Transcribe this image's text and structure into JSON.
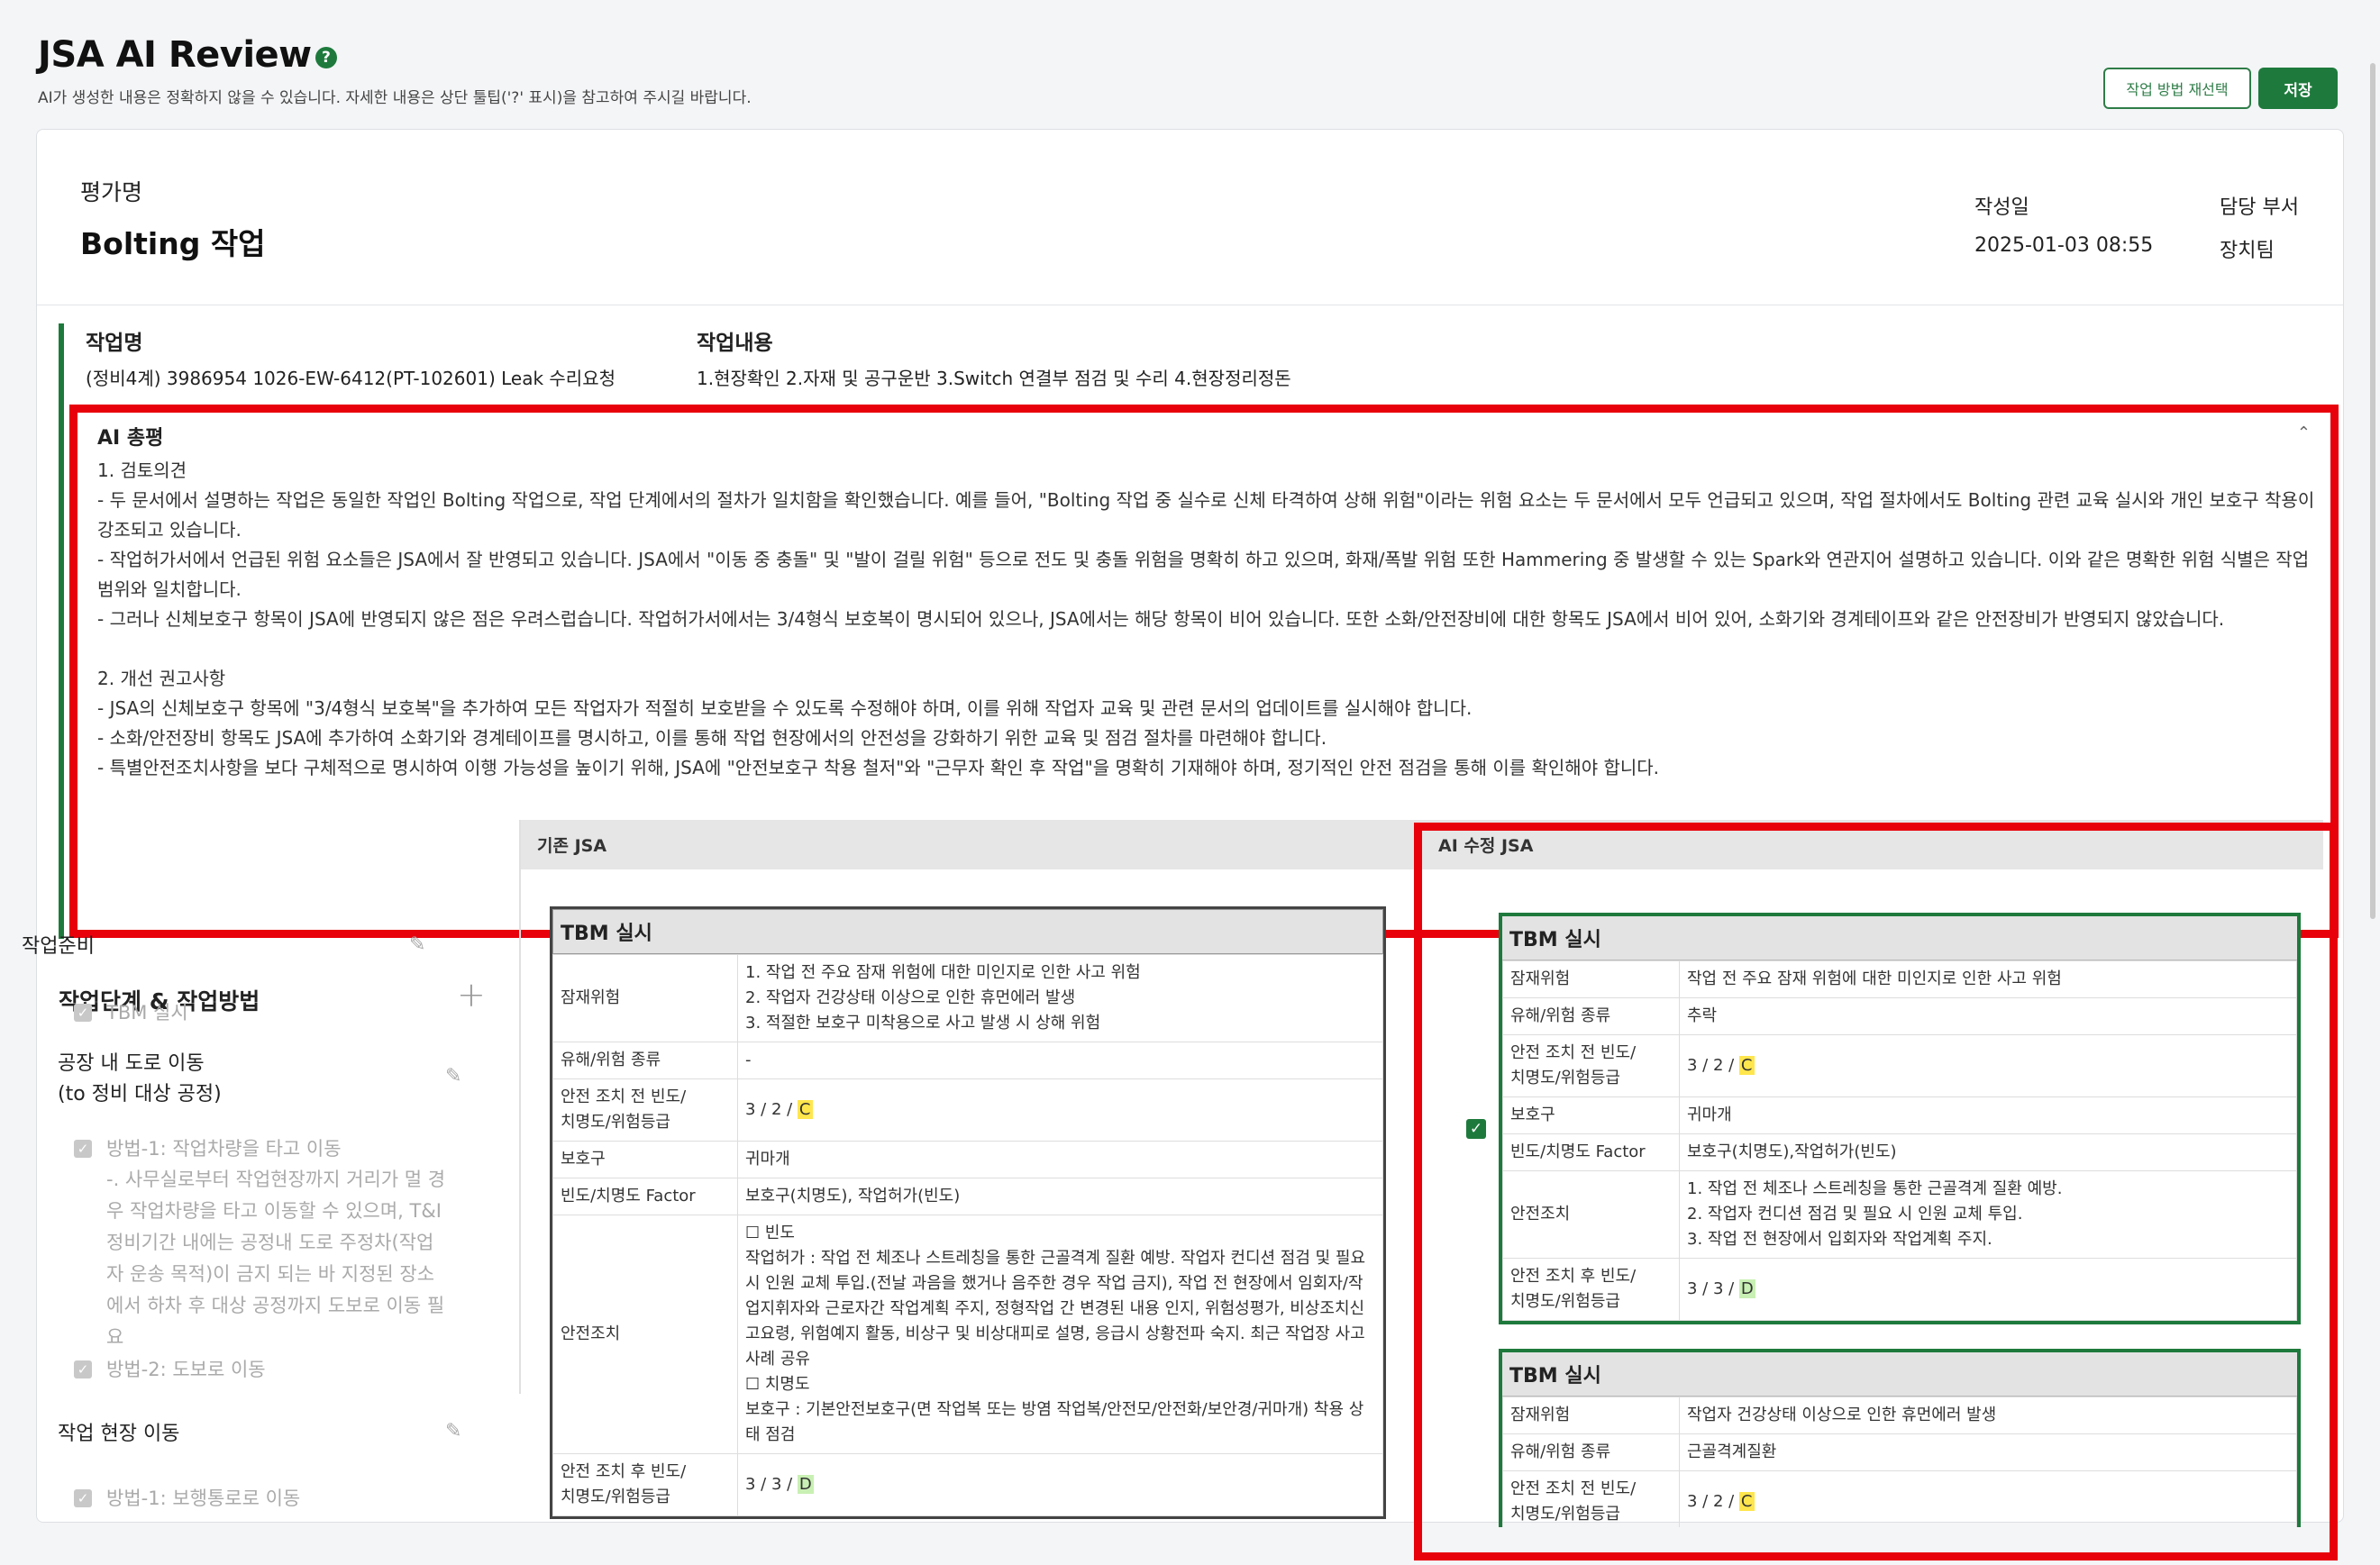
{
  "header": {
    "title": "JSA AI Review",
    "help_icon": "help-icon",
    "subtitle": "AI가 생성한 내용은 정확하지 않을 수 있습니다. 자세한 내용은 상단 툴팁('?' 표시)을 참고하여 주시길 바랍니다.",
    "reselect_button": "작업 방법 재선택",
    "save_button": "저장"
  },
  "evaluation": {
    "name_label": "평가명",
    "name": "Bolting 작업",
    "date_label": "작성일",
    "date": "2025-01-03 08:55",
    "dept_label": "담당 부서",
    "dept": "장치팀"
  },
  "job": {
    "name_label": "작업명",
    "name": "(정비4계) 3986954 1026-EW-6412(PT-102601) Leak 수리요청",
    "content_label": "작업내용",
    "content": "1.현장확인 2.자재 및 공구운반 3.Switch 연결부 점검 및 수리 4.현장정리정돈"
  },
  "ai_summary": {
    "title": "AI 총평",
    "lines": [
      "1. 검토의견",
      "  - 두 문서에서 설명하는 작업은 동일한 작업인 Bolting 작업으로, 작업 단계에서의 절차가 일치함을 확인했습니다. 예를 들어, \"Bolting 작업 중 실수로 신체 타격하여 상해 위험\"이라는 위험 요소는 두 문서에서 모두 언급되고 있으며, 작업 절차에서도 Bolting 관련 교육 실시와 개인 보호구 착용이 강조되고 있습니다.",
      "  - 작업허가서에서 언급된 위험 요소들은 JSA에서 잘 반영되고 있습니다. JSA에서 \"이동 중 충돌\" 및 \"발이 걸릴 위험\" 등으로 전도 및 충돌 위험을 명확히 하고 있으며, 화재/폭발 위험 또한 Hammering 중 발생할 수 있는 Spark와 연관지어 설명하고 있습니다. 이와 같은 명확한 위험 식별은 작업 범위와 일치합니다.",
      "  - 그러나 신체보호구 항목이 JSA에 반영되지 않은 점은 우려스럽습니다. 작업허가서에서는 3/4형식 보호복이 명시되어 있으나, JSA에서는 해당 항목이 비어 있습니다. 또한 소화/안전장비에 대한 항목도 JSA에서 비어 있어, 소화기와 경계테이프와 같은 안전장비가 반영되지 않았습니다.",
      "",
      "2. 개선 권고사항",
      "  - JSA의 신체보호구 항목에 \"3/4형식 보호복\"을 추가하여 모든 작업자가 적절히 보호받을 수 있도록 수정해야 하며, 이를 위해 작업자 교육 및 관련 문서의 업데이트를 실시해야 합니다.",
      "  - 소화/안전장비 항목도 JSA에 추가하여 소화기와 경계테이프를 명시하고, 이를 통해 작업 현장에서의 안전성을 강화하기 위한 교육 및 점검 절차를 마련해야 합니다.",
      "  - 특별안전조치사항을 보다 구체적으로 명시하여 이행 가능성을 높이기 위해, JSA에 \"안전보호구 착용 철저\"와 \"근무자 확인 후 작업\"을 명확히 기재해야 하며, 정기적인 안전 점검을 통해 이를 확인해야 합니다."
    ]
  },
  "steps_panel": {
    "title": "작업단계 & 작업방법",
    "stages": [
      {
        "label": "작업준비",
        "methods": [
          "TBM 실시"
        ]
      },
      {
        "label": "공장 내 도로 이동\n(to 정비 대상 공정)",
        "methods": [
          "방법-1: 작업차량을 타고 이동",
          "방법-2: 도보로 이동"
        ],
        "desc": "-. 사무실로부터 작업현장까지 거리가 멀 경우 작업차량을 타고 이동할 수 있으며, T&I 정비기간 내에는 공정내 도로 주정차(작업자 운송 목적)이 금지 되는 바 지정된 장소에서 하차 후 대상 공정까지 도보로 이동 필요"
      },
      {
        "label": "작업 현장 이동",
        "methods": [
          "방법-1: 보행통로로 이동"
        ]
      }
    ]
  },
  "existing_jsa": {
    "column_title": "기존 JSA",
    "table_title": "TBM 실시",
    "rows": {
      "hazard_k": "잠재위험",
      "hazard_v": "1. 작업 전 주요 잠재 위험에 대한 미인지로 인한 사고 위험\n2. 작업자 건강상태 이상으로 인한 휴먼에러 발생\n3. 적절한 보호구 미착용으로 사고 발생 시 상해 위험",
      "type_k": "유해/위험 종류",
      "type_v": "-",
      "pre_k": "안전 조치 전 빈도/\n치명도/위험등급",
      "pre_v": "3 / 2 / ",
      "pre_grade": "C",
      "ppe_k": "보호구",
      "ppe_v": "귀마개",
      "factor_k": "빈도/치명도 Factor",
      "factor_v": "보호구(치명도), 작업허가(빈도)",
      "measure_k": "안전조치",
      "measure_v": "☐ 빈도\n작업허가 : 작업 전 체조나 스트레칭을 통한 근골격계 질환 예방. 작업자 컨디션 점검 및 필요 시 인원 교체 투입.(전날 과음을 했거나 음주한 경우 작업 금지), 작업 전 현장에서 임회자/작업지휘자와 근로자간 작업계획 주지, 정형작업 간 변경된 내용 인지, 위험성평가, 비상조치신고요령, 위험예지 활동, 비상구 및 비상대피로 설명, 응급시 상황전파 숙지. 최근 작업장 사고사례 공유\n☐ 치명도\n보호구 : 기본안전보호구(면 작업복 또는 방염 작업복/안전모/안전화/보안경/귀마개) 착용 상태 점검",
      "post_k": "안전 조치 후 빈도/\n치명도/위험등급",
      "post_v": "3 / 3 / ",
      "post_grade": "D"
    }
  },
  "ai_jsa": {
    "column_title": "AI 수정 JSA",
    "tables": [
      {
        "title": "TBM 실시",
        "hazard_k": "잠재위험",
        "hazard_v": "작업 전 주요 잠재 위험에 대한 미인지로 인한 사고 위험",
        "type_k": "유해/위험 종류",
        "type_v": "추락",
        "pre_k": "안전 조치 전 빈도/\n치명도/위험등급",
        "pre_v": "3 / 2 / ",
        "pre_grade": "C",
        "ppe_k": "보호구",
        "ppe_v": "귀마개",
        "factor_k": "빈도/치명도 Factor",
        "factor_v": "보호구(치명도),작업허가(빈도)",
        "measure_k": "안전조치",
        "measure_v": "1. 작업 전 체조나 스트레칭을 통한 근골격계 질환 예방.\n2. 작업자 컨디션 점검 및 필요 시 인원 교체 투입.\n3. 작업 전 현장에서 입회자와 작업계획 주지.",
        "post_k": "안전 조치 후 빈도/\n치명도/위험등급",
        "post_v": "3 / 3 / ",
        "post_grade": "D"
      },
      {
        "title": "TBM 실시",
        "hazard_k": "잠재위험",
        "hazard_v": "작업자 건강상태 이상으로 인한 휴먼에러 발생",
        "type_k": "유해/위험 종류",
        "type_v": "근골격계질환",
        "pre_k": "안전 조치 전 빈도/\n치명도/위험등급",
        "pre_v": "3 / 2 / ",
        "pre_grade": "C"
      }
    ]
  },
  "colors": {
    "accent_green": "#1e7a3c",
    "highlight_red": "#e8000b",
    "grade_highlight": "#ffe64d"
  }
}
